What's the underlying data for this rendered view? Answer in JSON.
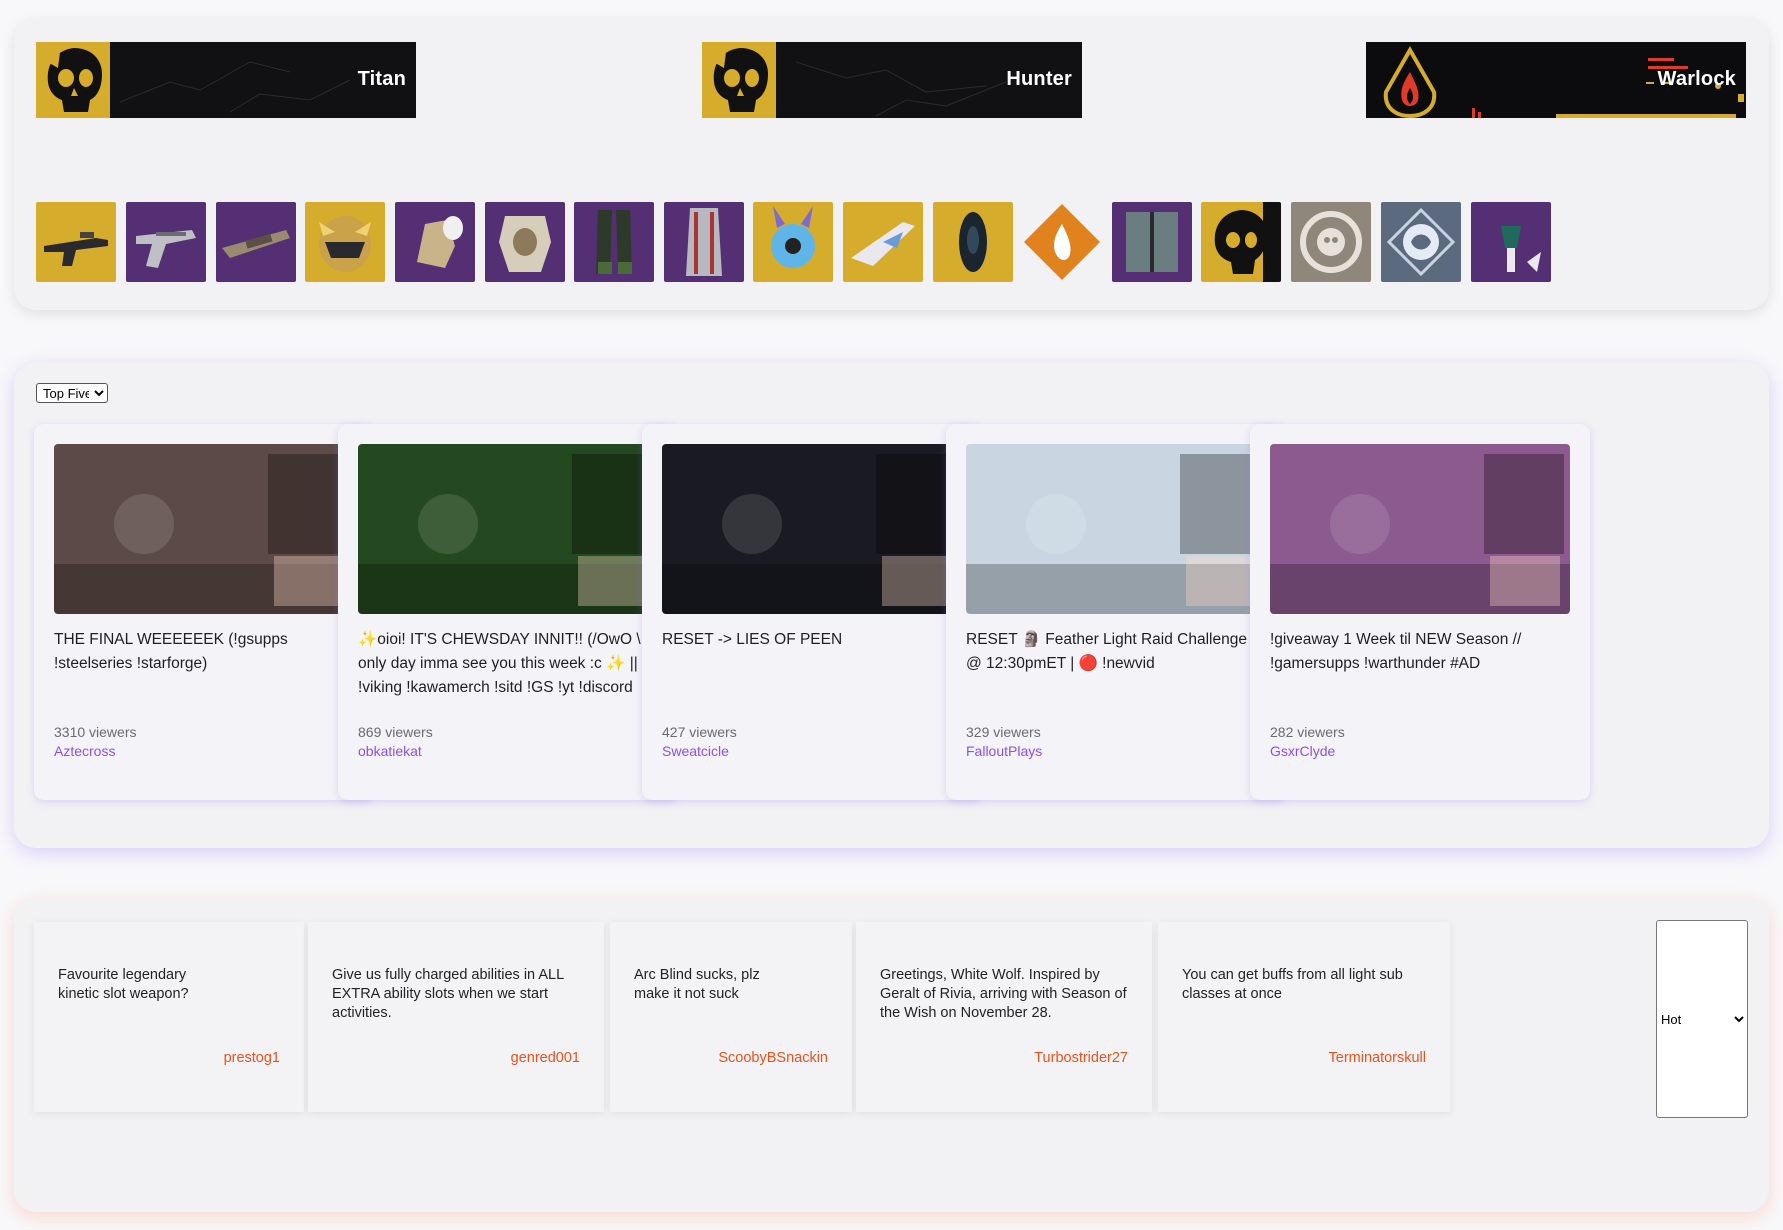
{
  "class_banners": [
    {
      "name": "Titan"
    },
    {
      "name": "Hunter"
    },
    {
      "name": "Warlock"
    }
  ],
  "gear_icons": [
    {
      "icon": "auto-rifle-icon",
      "bg": "#d6ac2c"
    },
    {
      "icon": "hand-cannon-icon",
      "bg": "#552f73"
    },
    {
      "icon": "shotgun-icon",
      "bg": "#552f73"
    },
    {
      "icon": "exotic-helmet-icon",
      "bg": "#d6ac2c"
    },
    {
      "icon": "gauntlets-icon",
      "bg": "#552f73"
    },
    {
      "icon": "chest-armor-icon",
      "bg": "#552f73"
    },
    {
      "icon": "leg-armor-icon",
      "bg": "#552f73"
    },
    {
      "icon": "class-item-icon",
      "bg": "#552f73"
    },
    {
      "icon": "ghost-shell-icon",
      "bg": "#d6ac2c"
    },
    {
      "icon": "sparrow-icon",
      "bg": "#d6ac2c"
    },
    {
      "icon": "ship-icon",
      "bg": "#d6ac2c"
    },
    {
      "icon": "solar-subclass-icon",
      "bg": "#e0821e"
    },
    {
      "icon": "shader-icon",
      "bg": "#552f73"
    },
    {
      "icon": "emblem-icon",
      "bg": "#d6ac2c"
    },
    {
      "icon": "finisher-icon",
      "bg": "#8f8779"
    },
    {
      "icon": "emote-icon",
      "bg": "#5c6a80"
    },
    {
      "icon": "transmat-icon",
      "bg": "#552f73"
    }
  ],
  "streams": {
    "filter": {
      "selected": "Top Five",
      "options": [
        "Top Five"
      ]
    },
    "items": [
      {
        "title": "THE FINAL WEEEEEEK (!gsupps !steelseries !starforge)",
        "viewers": "3310 viewers",
        "channel": "Aztecross",
        "thumb_color": "#5c4a46"
      },
      {
        "title": "✨oioi! IT'S CHEWSDAY INNIT!! (/OwO \\ ) only day imma see you this week :c ✨ || !viking !kawamerch !sitd !GS !yt !discord",
        "viewers": "869 viewers",
        "channel": "obkatiekat",
        "thumb_color": "#24481f"
      },
      {
        "title": "RESET -> LIES OF PEEN",
        "viewers": "427 viewers",
        "channel": "Sweatcicle",
        "thumb_color": "#1a1b22"
      },
      {
        "title": "RESET 🗿 Feather Light Raid Challenge @ 12:30pmET | 🔴 !newvid",
        "viewers": "329 viewers",
        "channel": "FalloutPlays",
        "thumb_color": "#c9d6e2"
      },
      {
        "title": "!giveaway 1 Week til NEW Season // !gamersupps !warthunder #AD",
        "viewers": "282 viewers",
        "channel": "GsxrClyde",
        "thumb_color": "#8d5a8f"
      }
    ]
  },
  "posts": {
    "sort": {
      "selected": "Hot",
      "options": [
        "Hot"
      ]
    },
    "items": [
      {
        "title": "Favourite legendary kinetic slot weapon?",
        "author": "prestog1"
      },
      {
        "title": "Give us fully charged abilities in ALL EXTRA ability slots when we start activities.",
        "author": "genred001"
      },
      {
        "title": "Arc Blind sucks, plz make it not suck",
        "author": "ScoobyBSnackin"
      },
      {
        "title": "Greetings, White Wolf. Inspired by Geralt of Rivia, arriving with Season of the Wish on November 28.",
        "author": "Turbostrider27"
      },
      {
        "title": "You can get buffs from all light sub classes at once",
        "author": "Terminatorskull"
      }
    ]
  },
  "colors": {
    "twitch_purple": "#8a4ff0",
    "reddit_orange": "#e8521e",
    "exotic_gold": "#d6ac2c",
    "legendary_purple": "#552f73"
  }
}
